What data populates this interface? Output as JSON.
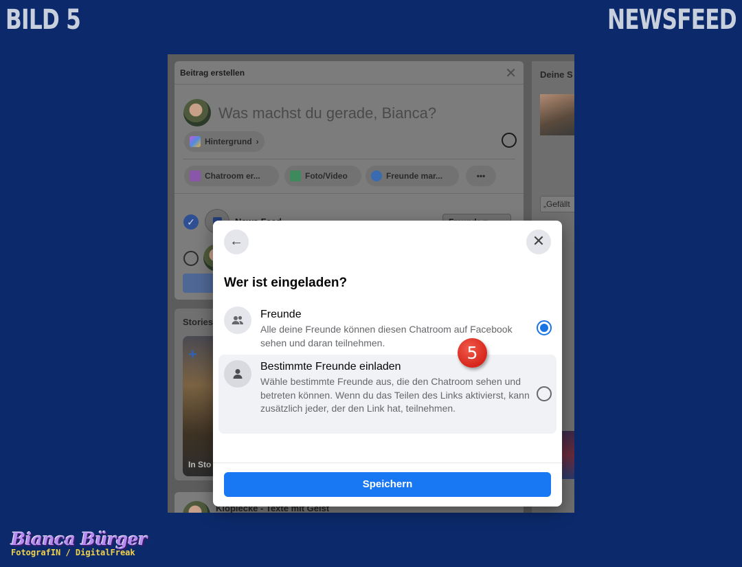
{
  "corner_left": "BILD 5",
  "corner_right": "NEWSFEED",
  "card": {
    "title": "Beitrag erstellen",
    "close": "✕",
    "prompt": "Was machst du gerade, Bianca?",
    "hintergrund": "Hintergrund",
    "chatroom": "Chatroom er...",
    "foto_video": "Foto/Video",
    "freunde_mar": "Freunde mar...",
    "more": "•••",
    "news_feed": "News Feed",
    "audience": "Freunde ▾"
  },
  "stories": {
    "title": "Stories",
    "plus": "+",
    "label": "In Sto"
  },
  "bottom_card": {
    "text": "Klopiecke - Texte mit Geist"
  },
  "right": {
    "title": "Deine S",
    "box": "„Gefällt"
  },
  "modal": {
    "back": "←",
    "close": "✕",
    "title": "Wer ist eingeladen?",
    "options": [
      {
        "title": "Freunde",
        "desc": "Alle deine Freunde können diesen Chatroom auf Facebook sehen und daran teilnehmen.",
        "selected": true
      },
      {
        "title": "Bestimmte Freunde einladen",
        "desc": "Wähle bestimmte Freunde aus, die den Chatroom sehen und betreten können. Wenn du das Teilen des Links aktivierst, kann zusätzlich jeder, der den Link hat, teilnehmen.",
        "selected": false
      }
    ],
    "save": "Speichern"
  },
  "step_badge": "5",
  "brand": {
    "name": "Bianca Bürger",
    "subtitle": "FotografIN / DigitalFreak"
  },
  "colors": {
    "background": "#0c2a6b",
    "accent": "#1877f2",
    "badge": "#d6261c"
  }
}
